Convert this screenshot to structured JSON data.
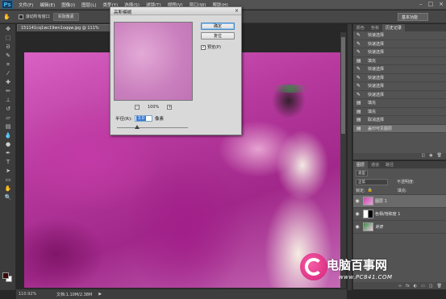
{
  "app": {
    "logo": "Ps",
    "menu": [
      "文件(F)",
      "编辑(E)",
      "图像(I)",
      "图层(L)",
      "类型(Y)",
      "选择(S)",
      "滤镜(T)",
      "视图(V)",
      "窗口(W)",
      "帮助(H)"
    ],
    "window_controls": [
      "–",
      "□",
      "×"
    ]
  },
  "options": {
    "scroll_all": "滚动所有窗口",
    "fit_screen": "实际像素",
    "workspace": "基本功能"
  },
  "doc": {
    "tab": "151141cq1wc19wn1oqqw.jpg @ 111%"
  },
  "status": {
    "zoom": "110.92%",
    "doc_size": "文档:1.10M/2.38M"
  },
  "dialog": {
    "title": "高斯模糊",
    "close": "×",
    "ok": "确定",
    "reset": "复位",
    "preview_label": "预览(P)",
    "preview_checked": "✓",
    "zoom_value": "100%",
    "zoom_minus": "−",
    "zoom_plus": "+",
    "radius_label": "半径(R):",
    "radius_value": "3.0",
    "radius_unit": "像素"
  },
  "history": {
    "tabs": [
      "颜色",
      "色板",
      "历史记录"
    ],
    "items": [
      {
        "label": "快速选择",
        "icon": "brush-icon"
      },
      {
        "label": "快速选择",
        "icon": "brush-icon"
      },
      {
        "label": "快速选择",
        "icon": "brush-icon"
      },
      {
        "label": "填充",
        "icon": "fill-icon"
      },
      {
        "label": "快速选择",
        "icon": "brush-icon"
      },
      {
        "label": "快速选择",
        "icon": "brush-icon"
      },
      {
        "label": "快速选择",
        "icon": "brush-icon"
      },
      {
        "label": "快速选择",
        "icon": "brush-icon"
      },
      {
        "label": "填充",
        "icon": "fill-icon"
      },
      {
        "label": "填充",
        "icon": "fill-icon"
      },
      {
        "label": "取消选择",
        "icon": "fill-icon"
      },
      {
        "label": "盖印可见图层",
        "icon": "fill-icon"
      }
    ]
  },
  "layers": {
    "tabs": [
      "图层",
      "通道",
      "路径"
    ],
    "kind": "类型",
    "blend": "正常",
    "opacity_label": "不透明度:",
    "lock_label": "锁定:",
    "fill_label": "填充:",
    "list": [
      {
        "name": "图层 1",
        "active": true
      },
      {
        "name": "色相/饱和度 1",
        "active": false
      },
      {
        "name": "背景",
        "active": false
      }
    ]
  },
  "watermark": {
    "brand": "电脑百事网",
    "url": "www.PC841.COM"
  },
  "colors": {
    "foreground": "#3a0808",
    "background": "#ffffff",
    "accent": "#3a7bd5"
  }
}
